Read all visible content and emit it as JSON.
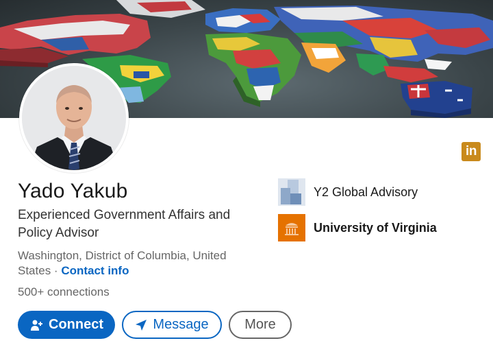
{
  "profile": {
    "name": "Yado Yakub",
    "headline": "Experienced Government Affairs and Policy Advisor",
    "location": "Washington, District of Columbia, United States",
    "location_separator": " · ",
    "contact_info": "Contact info",
    "connections": "500+ connections"
  },
  "organizations": [
    {
      "name": "Y2 Global Advisory",
      "logo": "y2-global-advisory-logo"
    },
    {
      "name": "University of Virginia",
      "logo": "university-of-virginia-logo"
    }
  ],
  "actions": {
    "connect": "Connect",
    "message": "Message",
    "more": "More"
  },
  "badge": {
    "text": "in",
    "icon": "linkedin-icon"
  },
  "colors": {
    "primary": "#0a66c2",
    "badge": "#c98a1c",
    "uva_orange": "#e57200"
  }
}
